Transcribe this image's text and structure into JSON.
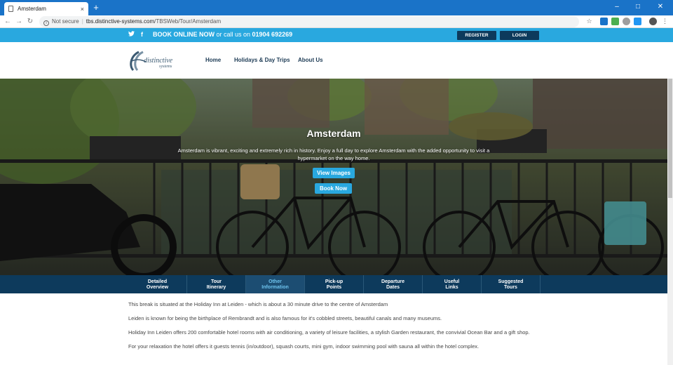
{
  "browser": {
    "tab_title": "Amsterdam",
    "tab_close": "×",
    "new_tab": "+",
    "security_label": "Not secure",
    "url_host": "tbs.distinctive-systems.com",
    "url_path": "/TBSWeb/Tour/Amsterdam"
  },
  "topbar": {
    "book_online": "BOOK ONLINE NOW",
    "call_us": " or call us on ",
    "phone": "01904 692269",
    "register_label": "REGISTER",
    "login_label": "LOGIN",
    "social": [
      "twitter-icon",
      "facebook-icon"
    ]
  },
  "header": {
    "logo_text": "distinctive",
    "logo_sub": "systems",
    "nav": [
      "Home",
      "Holidays & Day Trips",
      "About Us"
    ]
  },
  "hero": {
    "title": "Amsterdam",
    "description": "Amsterdam is vibrant, exciting and extremely rich in history. Enjoy a full day to explore Amsterdam with the added opportunity to visit a hypermarket on the way home.",
    "view_images_label": "View Images",
    "book_now_label": "Book Now"
  },
  "subtabs": [
    {
      "line1": "Detailed",
      "line2": "Overview"
    },
    {
      "line1": "Tour",
      "line2": "Itinerary"
    },
    {
      "line1": "Other",
      "line2": "Information"
    },
    {
      "line1": "Pick-up",
      "line2": "Points"
    },
    {
      "line1": "Departure",
      "line2": "Dates"
    },
    {
      "line1": "Useful",
      "line2": "Links"
    },
    {
      "line1": "Suggested",
      "line2": "Tours"
    }
  ],
  "active_tab": "Other Information",
  "content": [
    "This break is situated at the Holiday Inn at Leiden - which is about a 30 minute drive to the centre of Amsterdam",
    "Leiden is known for being the birthplace of Rembrandt and is also famous for it's cobbled streets, beautiful canals and many museums.",
    "Holiday Inn Leiden offers 200 comfortable hotel rooms with air conditioning, a variety of leisure facilities, a stylish Garden restaurant, the convivial Ocean Bar and a gift shop.",
    "For your relaxation the hotel offers it guests tennis (in/outdoor), squash courts, mini gym, indoor swimming pool with sauna all within the hotel complex."
  ],
  "colors": {
    "accent": "#29a8df",
    "navy": "#0d3a5c",
    "chrome": "#1a73c8"
  }
}
